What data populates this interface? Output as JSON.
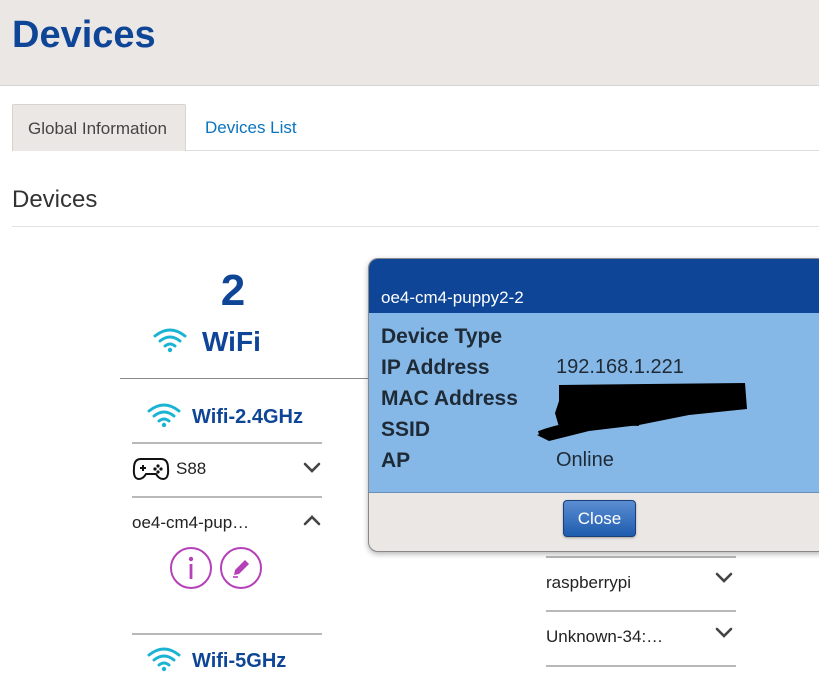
{
  "header": {
    "title": "Devices"
  },
  "tabs": [
    {
      "label": "Global Information",
      "active": true
    },
    {
      "label": "Devices List",
      "active": false
    }
  ],
  "section": {
    "title": "Devices"
  },
  "wifi": {
    "count": "2",
    "label": "WiFi",
    "bands": [
      {
        "label": "Wifi-2.4GHz",
        "devices": [
          {
            "name": "S88",
            "icon": "gamepad-icon",
            "expanded": false
          },
          {
            "name": "oe4-cm4-pup…",
            "expanded": true
          }
        ]
      },
      {
        "label": "Wifi-5GHz",
        "devices": []
      }
    ]
  },
  "right_devices": [
    {
      "name": "raspberrypi"
    },
    {
      "name": "Unknown-34:…"
    }
  ],
  "modal": {
    "title": "oe4-cm4-puppy2-2",
    "fields": [
      {
        "key": "Device Type",
        "value": ""
      },
      {
        "key": "IP Address",
        "value": "192.168.1.221"
      },
      {
        "key": "MAC Address",
        "value": ""
      },
      {
        "key": "SSID",
        "value": ""
      },
      {
        "key": "AP",
        "value": "Online"
      }
    ],
    "close_label": "Close"
  },
  "colors": {
    "brand": "#0e4597",
    "link": "#0a74c0",
    "wifi_icon": "#1bb3d3",
    "action": "#b640b8",
    "modal_body": "#85b8e6"
  }
}
